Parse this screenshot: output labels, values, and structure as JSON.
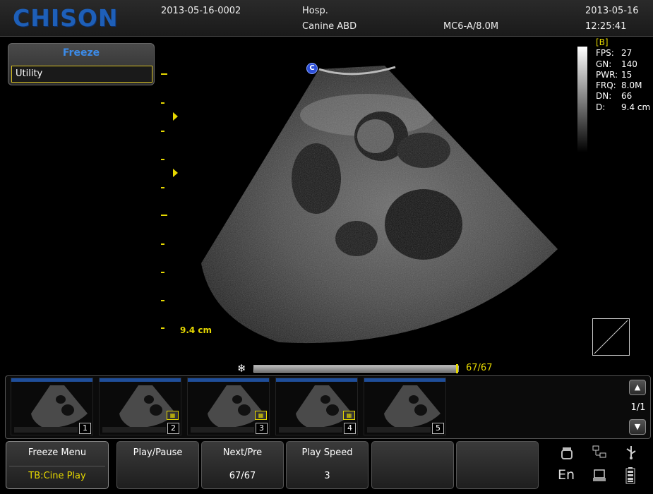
{
  "header": {
    "brand": "CHISON",
    "patient_id": "2013-05-16-0002",
    "hospital": "Hosp.",
    "exam": "Canine ABD",
    "probe": "MC6-A/8.0M",
    "date": "2013-05-16",
    "time": "12:25:41"
  },
  "menu": {
    "title": "Freeze",
    "items": [
      {
        "label": "Utility"
      }
    ]
  },
  "image": {
    "orientation_marker": "C",
    "depth_label": "9.4 cm"
  },
  "params": {
    "mode": "[B]",
    "rows": [
      {
        "key": "FPS:",
        "value": "27"
      },
      {
        "key": "GN:",
        "value": "140"
      },
      {
        "key": "PWR:",
        "value": "15"
      },
      {
        "key": "FRQ:",
        "value": "8.0M"
      },
      {
        "key": "DN:",
        "value": "66"
      },
      {
        "key": "D:",
        "value": "9.4 cm"
      }
    ]
  },
  "cine": {
    "counter": "67/67",
    "progress": 1.0,
    "icon": "snowflake-icon"
  },
  "thumbnails": [
    {
      "number": "1"
    },
    {
      "number": "2",
      "saved": true
    },
    {
      "number": "3",
      "saved": true
    },
    {
      "number": "4",
      "saved": true
    },
    {
      "number": "5"
    }
  ],
  "strip": {
    "page": "1/1"
  },
  "softkeys": [
    {
      "label": "Freeze Menu",
      "value": "TB:Cine Play"
    },
    {
      "label": "Play/Pause",
      "value": ""
    },
    {
      "label": "Next/Pre",
      "value": "67/67"
    },
    {
      "label": "Play Speed",
      "value": "3"
    },
    {
      "label": "",
      "value": ""
    },
    {
      "label": "",
      "value": ""
    }
  ],
  "status": {
    "language": "En",
    "icons": [
      "probe-icon",
      "network-icon",
      "usb-icon",
      "printer-icon",
      "battery-icon"
    ]
  },
  "colors": {
    "accent_yellow": "#e6d800",
    "brand_blue": "#1e5fb8",
    "menu_title_blue": "#3c8be8"
  }
}
